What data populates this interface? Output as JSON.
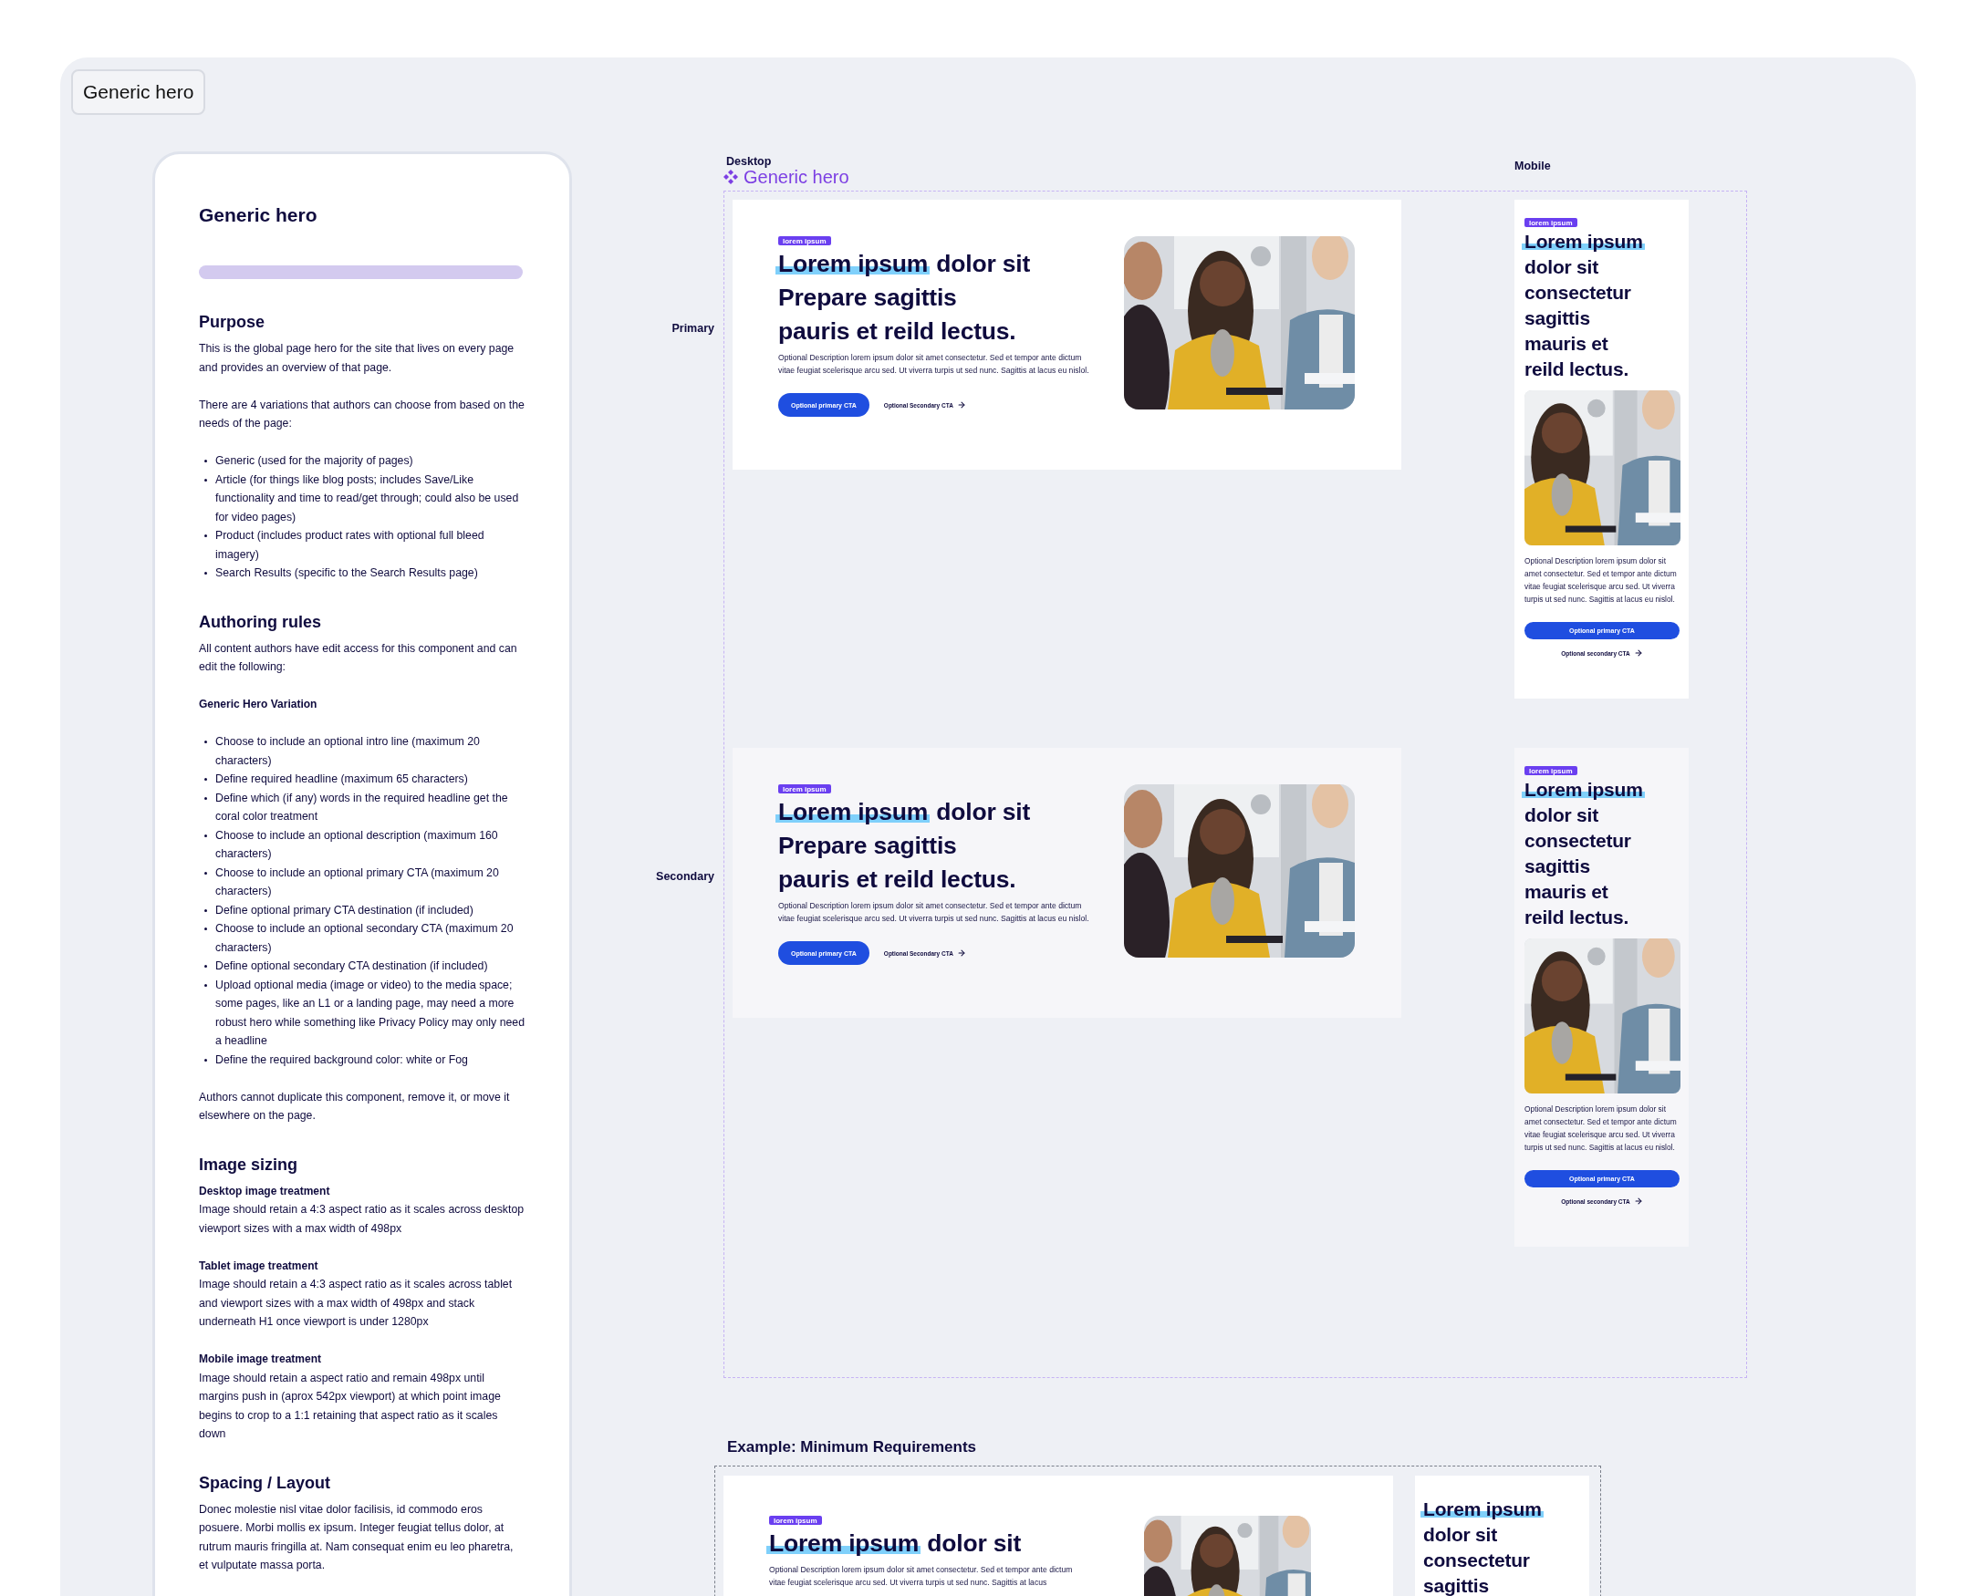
{
  "frame_tag": "Generic hero",
  "doc": {
    "title": "Generic hero",
    "sections": [
      {
        "heading": "Purpose",
        "blocks": [
          {
            "kind": "p",
            "text": "This is the global page hero for the site that lives on every page and provides an overview of that page."
          },
          {
            "kind": "p",
            "text": "There are 4 variations that authors can choose from based on the needs of the page:"
          },
          {
            "kind": "list",
            "items": [
              "Generic (used for the majority of pages)",
              "Article (for things like blog posts; includes Save/Like functionality and time to read/get through; could also be used for video pages)",
              "Product (includes product rates with optional full bleed imagery)",
              "Search Results (specific to the Search Results page)"
            ]
          }
        ]
      },
      {
        "heading": "Authoring rules",
        "blocks": [
          {
            "kind": "p",
            "text": "All content authors have edit access for this component and can edit the following:"
          },
          {
            "kind": "subhead",
            "text": "Generic Hero Variation"
          },
          {
            "kind": "list",
            "items": [
              "Choose to include an optional intro line (maximum 20 characters)",
              "Define required headline (maximum 65 characters)",
              "Define which (if any) words in the required headline get the coral color treatment",
              "Choose to include an optional description (maximum 160 characters)",
              "Choose to include an optional primary CTA (maximum 20 characters)",
              "Define optional primary CTA destination (if included)",
              "Choose to include an optional secondary CTA (maximum 20 characters)",
              "Define optional secondary CTA destination (if included)",
              "Upload optional media (image or video) to the media space; some pages, like an L1 or a landing page, may need a more robust hero while something like Privacy Policy may only need a headline",
              "Define the required background color: white or Fog"
            ]
          },
          {
            "kind": "p",
            "text": "Authors cannot duplicate this component, remove it, or move it elsewhere on the page."
          }
        ]
      },
      {
        "heading": "Image sizing",
        "blocks": [
          {
            "kind": "label",
            "text": "Desktop image treatment"
          },
          {
            "kind": "p",
            "text": "Image should retain a 4:3 aspect ratio as it scales across desktop viewport sizes with a max width of 498px"
          },
          {
            "kind": "label",
            "text": "Tablet image treatment"
          },
          {
            "kind": "p",
            "text": "Image should retain a 4:3 aspect ratio as it scales across tablet and viewport sizes with a max width of 498px and stack underneath H1 once viewport is under 1280px"
          },
          {
            "kind": "label",
            "text": "Mobile image treatment"
          },
          {
            "kind": "p",
            "text": "Image should retain a aspect ratio and remain 498px until margins push in (aprox 542px viewport) at which point image begins to crop to a 1:1 retaining that aspect ratio as it scales down"
          }
        ]
      },
      {
        "heading": "Spacing / Layout",
        "blocks": [
          {
            "kind": "p",
            "text": "Donec molestie nisl vitae dolor facilisis, id commodo eros posuere. Morbi mollis ex ipsum. Integer feugiat tellus dolor, at rutrum mauris fringilla at. Nam consequat enim eu leo pharetra, et vulputate massa porta."
          }
        ]
      }
    ]
  },
  "showcase": {
    "desktop_label": "Desktop",
    "component_name": "Generic hero",
    "mobile_label": "Mobile",
    "rows": [
      {
        "label": "Primary",
        "color": "#ffffff",
        "desktop": {
          "tag": "lorem ipsum",
          "headline": {
            "highlight": "Lorem ipsum",
            "first_rest": "dolor sit",
            "lines": [
              "Prepare sagittis",
              "pauris et reild lectus."
            ]
          },
          "description": "Optional Description lorem ipsum dolor sit amet consectetur. Sed et tempor ante dictum vitae feugiat scelerisque arcu sed. Ut viverra turpis ut sed nunc. Sagittis at lacus eu nislol.",
          "primary_cta": "Optional primary CTA",
          "secondary_cta": "Optional Secondary CTA"
        },
        "mobile": {
          "tag": "lorem ipsum",
          "headline": {
            "highlight": "Lorem ipsum",
            "lines": [
              "dolor sit",
              "consectetur",
              "sagittis",
              "mauris et",
              "reild lectus."
            ]
          },
          "description": "Optional Description lorem ipsum dolor sit amet consectetur. Sed et tempor ante dictum vitae feugiat scelerisque arcu sed. Ut viverra turpis ut sed nunc. Sagittis at lacus eu nislol.",
          "primary_cta": "Optional primary CTA",
          "secondary_cta": "Optional secondary CTA"
        }
      },
      {
        "label": "Secondary",
        "color": "#f6f6f9",
        "desktop": {
          "tag": "lorem ipsum",
          "headline": {
            "highlight": "Lorem ipsum",
            "first_rest": "dolor sit",
            "lines": [
              "Prepare sagittis",
              "pauris et reild lectus."
            ]
          },
          "description": "Optional Description lorem ipsum dolor sit amet consectetur. Sed et tempor ante dictum vitae feugiat scelerisque arcu sed. Ut viverra turpis ut sed nunc. Sagittis at lacus eu nislol.",
          "primary_cta": "Optional primary CTA",
          "secondary_cta": "Optional Secondary CTA"
        },
        "mobile": {
          "tag": "lorem ipsum",
          "headline": {
            "highlight": "Lorem ipsum",
            "lines": [
              "dolor sit",
              "consectetur",
              "sagittis",
              "mauris et",
              "reild lectus."
            ]
          },
          "description": "Optional Description lorem ipsum dolor sit amet consectetur. Sed et tempor ante dictum vitae feugiat scelerisque arcu sed. Ut viverra turpis ut sed nunc. Sagittis at lacus eu nislol.",
          "primary_cta": "Optional primary CTA",
          "secondary_cta": "Optional secondary CTA"
        }
      }
    ]
  },
  "minimum_example": {
    "title": "Example: Minimum Requirements",
    "desktop": {
      "tag": "lorem ipsum",
      "headline": {
        "highlight": "Lorem ipsum",
        "first_rest": "dolor sit"
      },
      "description": "Optional Description lorem ipsum dolor sit amet consectetur. Sed et tempor ante dictum vitae feugiat scelerisque arcu sed. Ut viverra turpis ut sed nunc. Sagittis at lacus"
    },
    "mobile": {
      "headline": {
        "highlight": "Lorem ipsum",
        "lines": [
          "dolor sit",
          "consectetur",
          "sagittis"
        ]
      }
    }
  }
}
